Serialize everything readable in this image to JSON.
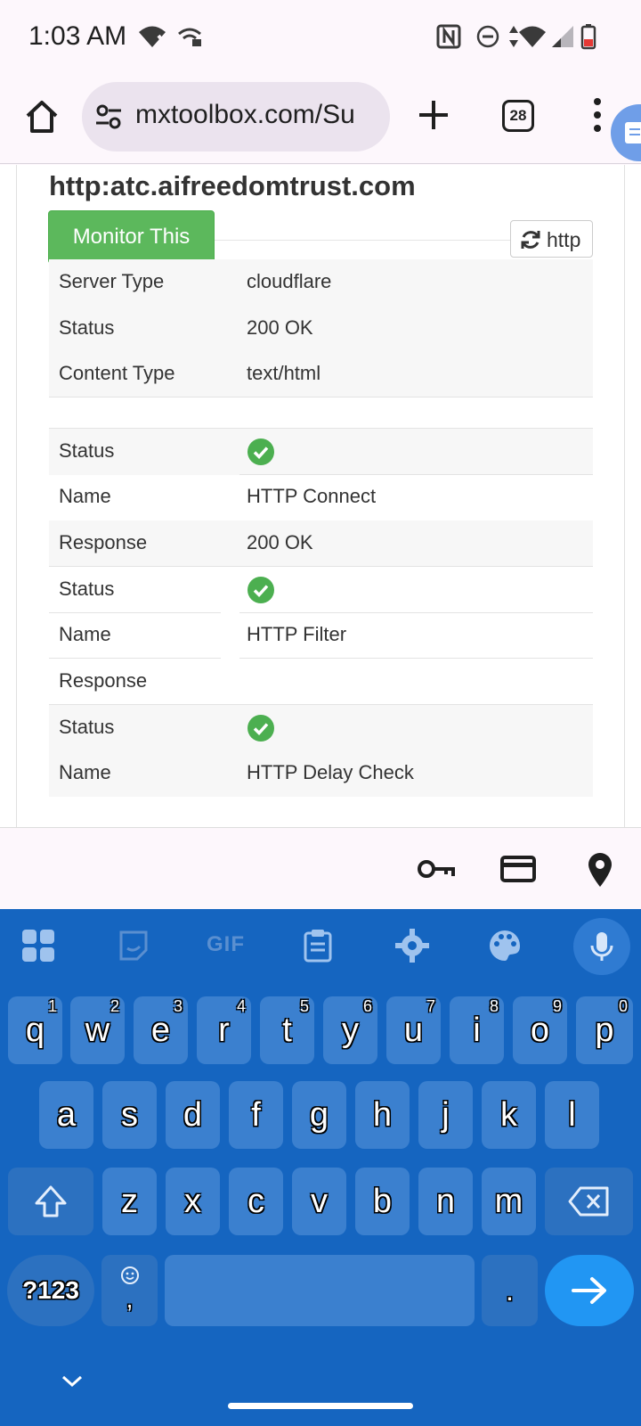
{
  "status_bar": {
    "time": "1:03 AM",
    "icons": [
      "wifi-off-icon",
      "hotspot-icon",
      "nfc-icon",
      "dnd-icon",
      "data-arrows-icon",
      "wifi-icon",
      "signal-icon",
      "battery-icon"
    ]
  },
  "browser": {
    "url": "mxtoolbox.com/Su",
    "tab_count": "28"
  },
  "page": {
    "title": "http:atc.aifreedomtrust.com",
    "monitor_button": "Monitor This",
    "refresh_button": "http",
    "info_rows": [
      {
        "key": "Server Type",
        "value": "cloudflare"
      },
      {
        "key": "Status",
        "value": "200 OK"
      },
      {
        "key": "Content Type",
        "value": "text/html"
      }
    ],
    "checks": [
      {
        "status_label": "Status",
        "status": "pass",
        "name_label": "Name",
        "name": "HTTP Connect",
        "response_label": "Response",
        "response": "200 OK"
      },
      {
        "status_label": "Status",
        "status": "pass",
        "name_label": "Name",
        "name": "HTTP Filter",
        "response_label": "Response",
        "response": ""
      },
      {
        "status_label": "Status",
        "status": "pass",
        "name_label": "Name",
        "name": "HTTP Delay Check"
      }
    ]
  },
  "accessory_bar": {
    "icons": [
      "key-icon",
      "credit-card-icon",
      "location-pin-icon"
    ]
  },
  "keyboard": {
    "toolbar": [
      "apps-grid-icon",
      "sticker-icon",
      "gif-icon",
      "clipboard-icon",
      "settings-gear-icon",
      "palette-icon",
      "microphone-icon"
    ],
    "gif_label": "GIF",
    "row1": [
      {
        "key": "q",
        "hint": "1"
      },
      {
        "key": "w",
        "hint": "2"
      },
      {
        "key": "e",
        "hint": "3"
      },
      {
        "key": "r",
        "hint": "4"
      },
      {
        "key": "t",
        "hint": "5"
      },
      {
        "key": "y",
        "hint": "6"
      },
      {
        "key": "u",
        "hint": "7"
      },
      {
        "key": "i",
        "hint": "8"
      },
      {
        "key": "o",
        "hint": "9"
      },
      {
        "key": "p",
        "hint": "0"
      }
    ],
    "row2": [
      "a",
      "s",
      "d",
      "f",
      "g",
      "h",
      "j",
      "k",
      "l"
    ],
    "row3": [
      "z",
      "x",
      "c",
      "v",
      "b",
      "n",
      "m"
    ],
    "symbols_key": "?123",
    "comma_key": ",",
    "period_key": ".",
    "accent_color": "#1565c0"
  }
}
